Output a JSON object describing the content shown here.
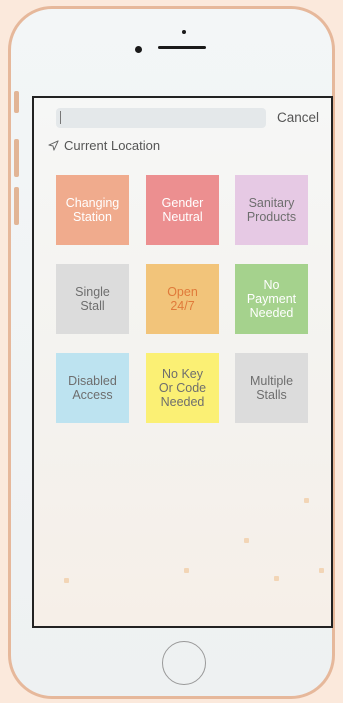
{
  "search": {
    "value": "",
    "cancel_label": "Cancel"
  },
  "location": {
    "label": "Current Location",
    "icon": "location-arrow-icon"
  },
  "tiles": [
    {
      "label_lines": [
        "Changing",
        "Station"
      ],
      "color": "#f0ab8d"
    },
    {
      "label_lines": [
        "Gender",
        "Neutral"
      ],
      "color": "#ec8f90"
    },
    {
      "label_lines": [
        "Sanitary",
        "Products"
      ],
      "color": "#e6c9e4"
    },
    {
      "label_lines": [
        "Single",
        "Stall"
      ],
      "color": "#dcdcdc"
    },
    {
      "label_lines": [
        "Open",
        "24/7"
      ],
      "color": "#f2c47a"
    },
    {
      "label_lines": [
        "No",
        "Payment",
        "Needed"
      ],
      "color": "#a5d28d"
    },
    {
      "label_lines": [
        "Disabled",
        "Access"
      ],
      "color": "#bde3f0"
    },
    {
      "label_lines": [
        "No Key",
        "Or Code",
        "Needed"
      ],
      "color": "#fbf074"
    },
    {
      "label_lines": [
        "Multiple",
        "Stalls"
      ],
      "color": "#dcdcdc"
    }
  ],
  "tile_text_colors": [
    "#ffffff",
    "#ffffff",
    "#6e6e6e",
    "#6e6e6e",
    "#e07a3a",
    "#ffffff",
    "#6e6e6e",
    "#6e6e6e",
    "#6e6e6e"
  ]
}
